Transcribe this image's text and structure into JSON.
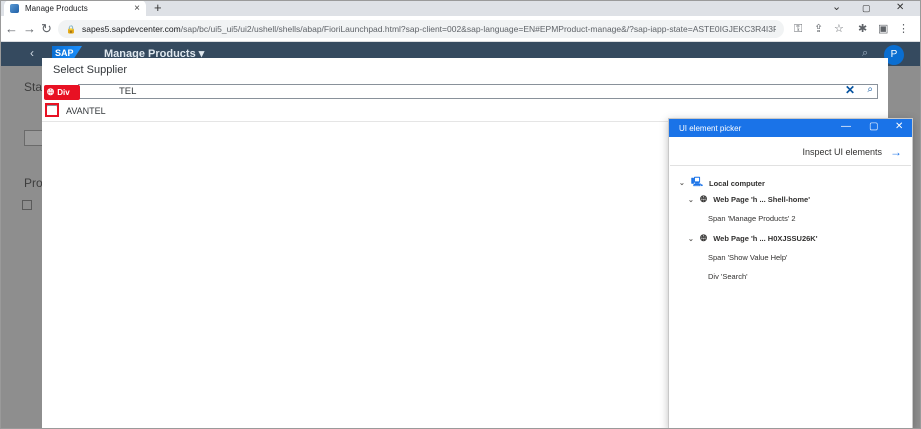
{
  "browser": {
    "tab_title": "Manage Products",
    "tab_close": "×",
    "new_tab": "+",
    "url_host": "sapes5.sapdevcenter.com",
    "url_path": "/sap/bc/ui5_ui5/ui2/ushell/shells/abap/FioriLaunchpad.html?sap-client=002&sap-language=EN#EPMProduct-manage&/?sap-iapp-state=ASTE0IGJEKC3R4I3PF...",
    "window_minimize": "⌄",
    "window_restore": "▢",
    "window_close": "✕"
  },
  "sap": {
    "app_title": "Manage Products ▾",
    "logo": "SAP",
    "avatar_initial": "P",
    "bg_text_1": "Sta",
    "bg_text_2": "Pro"
  },
  "dialog": {
    "title": "Select Supplier",
    "search_value": "TEL",
    "items": [
      {
        "label": "AVANTEL"
      }
    ]
  },
  "highlight": {
    "tag_label": "Div"
  },
  "picker": {
    "title": "UI element picker",
    "inspect_label": "Inspect UI elements",
    "tree": {
      "root": "Local computer",
      "page1": "Web Page 'h ... Shell-home'",
      "page1_child": "Span 'Manage Products' 2",
      "page2": "Web Page 'h ... H0XJSSU26K'",
      "page2_child1": "Span 'Show Value Help'",
      "page2_child2": "Div 'Search'"
    }
  }
}
